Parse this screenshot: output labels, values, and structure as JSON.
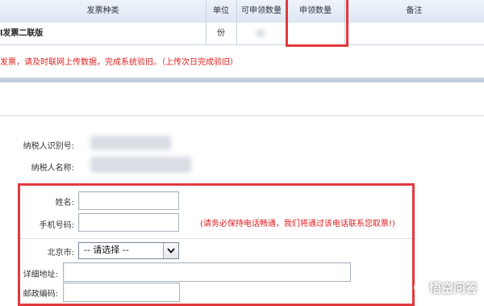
{
  "table": {
    "headers": {
      "type": "发票种类",
      "unit": "单位",
      "available_qty": "可申领数量",
      "apply_qty": "申领数量",
      "remark": "备注"
    },
    "row": {
      "type": "l发票二联版",
      "unit": "份"
    }
  },
  "notice": "发票，请及时联网上传数据，完成系统验旧。（上传次日完成验旧）",
  "taxpayer": {
    "id_label": "纳税人识别号:",
    "name_label": "纳税人名称:"
  },
  "contact": {
    "name_label": "姓名:",
    "phone_label": "手机号码:",
    "phone_hint": "(请务必保持电话畅通，我们将通过该电话联系您取票!)"
  },
  "address": {
    "city_label": "北京市:",
    "city_select_value": "-- 请选择 --",
    "detail_label": "详细地址:",
    "postal_label": "邮政编码:"
  },
  "watermark": "悟空问答",
  "colors": {
    "highlight_red": "#e0393e",
    "notice_red": "#e02020",
    "header_blue": "#dde7f2"
  }
}
